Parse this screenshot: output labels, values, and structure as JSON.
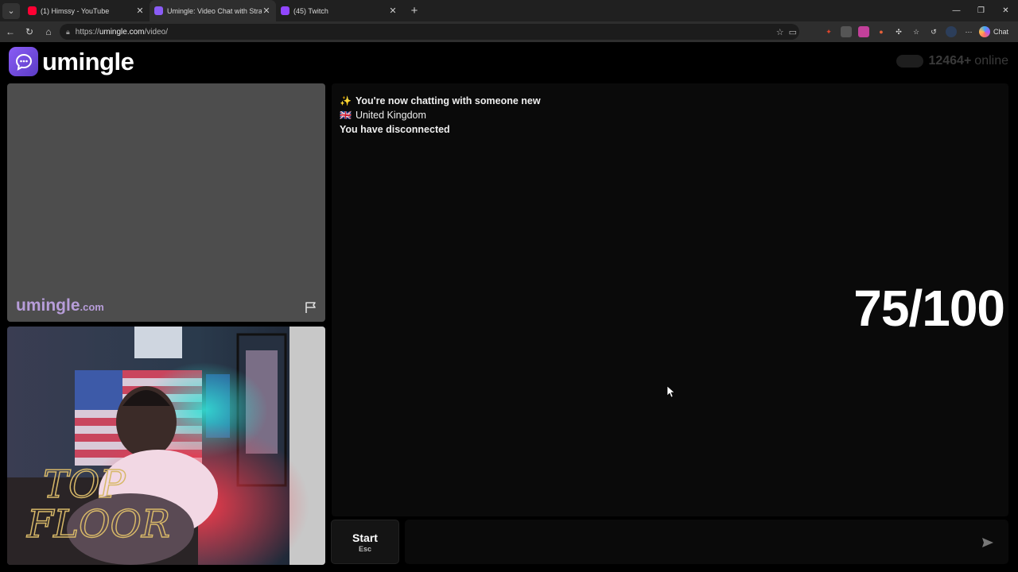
{
  "browser": {
    "tabs": [
      {
        "label": "(1) Himssy - YouTube",
        "favicon_color": "#ff0033",
        "active": false
      },
      {
        "label": "Umingle: Video Chat with Stra",
        "favicon_color": "#8a5cf6",
        "active": true
      },
      {
        "label": "(45) Twitch",
        "favicon_color": "#9146ff",
        "active": false
      }
    ],
    "url_prefix": "https://",
    "url_host": "umingle.com",
    "url_path": "/video/",
    "copilot_label": "Chat"
  },
  "page": {
    "brand_name": "umingle",
    "online_count": "12464+",
    "online_suffix": "online",
    "watermark_main": "umingle",
    "watermark_domain": ".com",
    "messages": [
      {
        "emoji": "✨",
        "text": "You're now chatting with someone new",
        "bold": true
      },
      {
        "emoji": "🇬🇧",
        "text": "United Kingdom",
        "bold": false
      },
      {
        "emoji": "",
        "text": "You have disconnected",
        "bold": true
      }
    ],
    "score_overlay": "75/100",
    "start_label": "Start",
    "start_hotkey": "Esc",
    "chat_placeholder": ""
  }
}
